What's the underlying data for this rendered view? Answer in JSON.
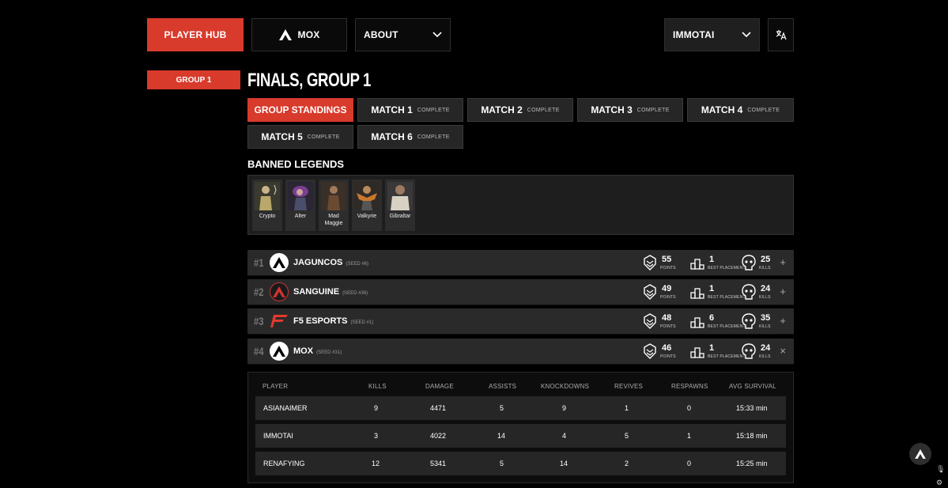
{
  "nav": {
    "player_hub": "PLAYER HUB",
    "team": "MOX",
    "about": "ABOUT",
    "language": "IMMOTAI"
  },
  "group_tag": "GROUP 1",
  "title": "FINALS, GROUP 1",
  "tabs": [
    {
      "label": "GROUP STANDINGS",
      "sub": ""
    },
    {
      "label": "MATCH 1",
      "sub": "COMPLETE"
    },
    {
      "label": "MATCH 2",
      "sub": "COMPLETE"
    },
    {
      "label": "MATCH 3",
      "sub": "COMPLETE"
    },
    {
      "label": "MATCH 4",
      "sub": "COMPLETE"
    },
    {
      "label": "MATCH 5",
      "sub": "COMPLETE"
    },
    {
      "label": "MATCH 6",
      "sub": "COMPLETE"
    }
  ],
  "banned": {
    "title": "BANNED LEGENDS",
    "legends": [
      "Crypto",
      "Alter",
      "Mad Maggie",
      "Valkyrie",
      "Gibraltar"
    ]
  },
  "stat_labels": {
    "points": "POINTS",
    "placement": "BEST PLACEMENT",
    "kills": "KILLS"
  },
  "teams": [
    {
      "rank": "#1",
      "name": "JAGUNCOS",
      "seed": "(SEED #6)",
      "points": "55",
      "placement": "1",
      "kills": "25",
      "toggle": "+"
    },
    {
      "rank": "#2",
      "name": "SANGUINE",
      "seed": "(SEED #36)",
      "points": "49",
      "placement": "1",
      "kills": "24",
      "toggle": "+"
    },
    {
      "rank": "#3",
      "name": "F5 ESPORTS",
      "seed": "(SEED #1)",
      "points": "48",
      "placement": "6",
      "kills": "35",
      "toggle": "+"
    },
    {
      "rank": "#4",
      "name": "MOX",
      "seed": "(SEED #31)",
      "points": "46",
      "placement": "1",
      "kills": "24",
      "toggle": "×"
    }
  ],
  "player_table": {
    "headers": [
      "PLAYER",
      "KILLS",
      "DAMAGE",
      "ASSISTS",
      "KNOCKDOWNS",
      "REVIVES",
      "RESPAWNS",
      "AVG SURVIVAL"
    ],
    "rows": [
      [
        "ASIANAIMER",
        "9",
        "4471",
        "5",
        "9",
        "1",
        "0",
        "15:33 min"
      ],
      [
        "IMMOTAI",
        "3",
        "4022",
        "14",
        "4",
        "5",
        "1",
        "15:18 min"
      ],
      [
        "RENAFYING",
        "12",
        "5341",
        "5",
        "14",
        "2",
        "0",
        "15:25 min"
      ]
    ]
  },
  "colors": {
    "accent": "#d83a2c",
    "row_bg": "#2a2a2a"
  }
}
